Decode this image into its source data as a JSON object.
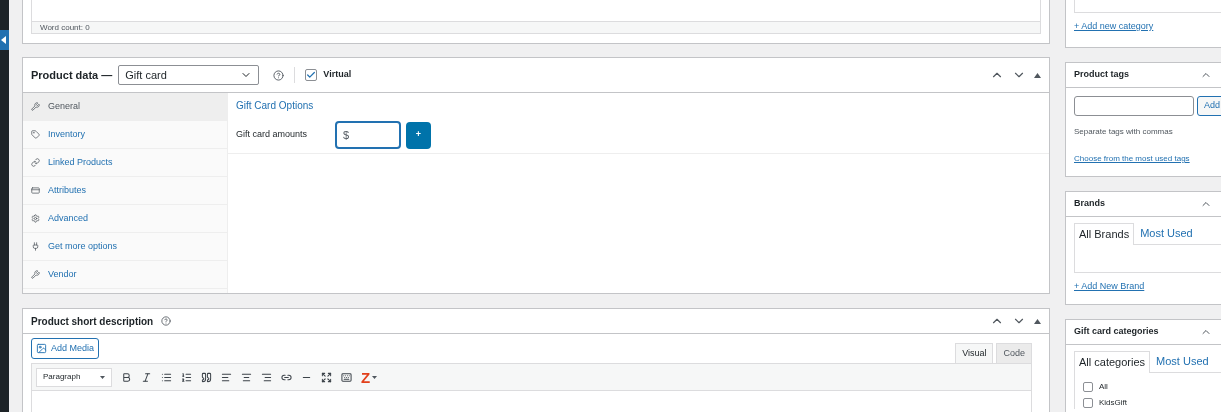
{
  "editor": {
    "word_count": "Word count: 0"
  },
  "product_data": {
    "title": "Product data —",
    "type": "Gift card",
    "virtual": {
      "label": "Virtual",
      "checked": true
    },
    "tabs": [
      {
        "label": "General",
        "selected": true
      },
      {
        "label": "Inventory",
        "selected": false
      },
      {
        "label": "Linked Products",
        "selected": false
      },
      {
        "label": "Attributes",
        "selected": false
      },
      {
        "label": "Advanced",
        "selected": false
      },
      {
        "label": "Get more options",
        "selected": false
      },
      {
        "label": "Vendor",
        "selected": false
      }
    ],
    "section_title": "Gift Card Options",
    "amounts": {
      "label": "Gift card amounts",
      "value": "$"
    },
    "add_button": "+"
  },
  "short_description": {
    "title": "Product short description",
    "add_media": "Add Media",
    "modes": [
      {
        "label": "Visual",
        "selected": true
      },
      {
        "label": "Code",
        "selected": false
      }
    ],
    "format": "Paragraph",
    "plugin_glyph": "Z"
  },
  "sidebar": {
    "categories": {
      "add_link": "+ Add new category"
    },
    "tags": {
      "title": "Product tags",
      "add_button": "Add",
      "hint": "Separate tags with commas",
      "link": "Choose from the most used tags"
    },
    "brands": {
      "title": "Brands",
      "tabs": [
        {
          "label": "All Brands",
          "selected": true
        },
        {
          "label": "Most Used",
          "selected": false
        }
      ],
      "add_link": "+ Add New Brand"
    },
    "gift_card_categories": {
      "title": "Gift card categories",
      "tabs": [
        {
          "label": "All categories",
          "selected": true
        },
        {
          "label": "Most Used",
          "selected": false
        }
      ],
      "items": [
        {
          "label": "All",
          "checked": false
        },
        {
          "label": "KidsGift",
          "checked": false
        }
      ]
    }
  }
}
